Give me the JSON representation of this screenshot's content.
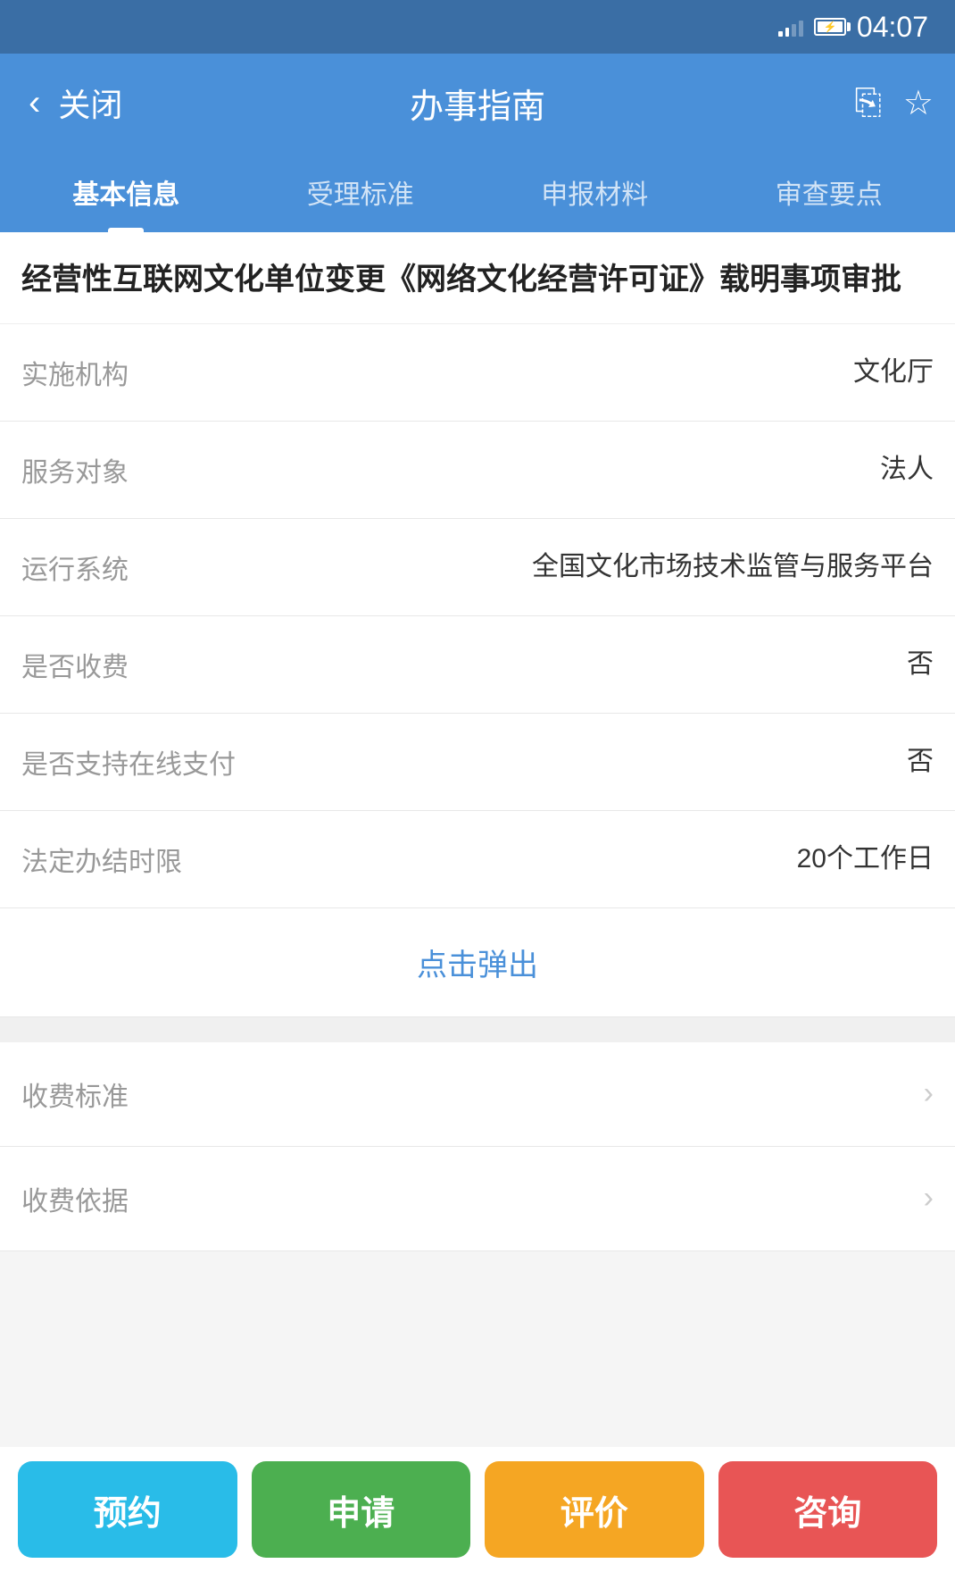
{
  "statusBar": {
    "time": "04:07"
  },
  "navbar": {
    "backLabel": "‹",
    "closeLabel": "关闭",
    "title": "办事指南",
    "shareIcon": "share",
    "starIcon": "star"
  },
  "tabs": [
    {
      "id": "basic",
      "label": "基本信息",
      "active": true
    },
    {
      "id": "standard",
      "label": "受理标准",
      "active": false
    },
    {
      "id": "materials",
      "label": "申报材料",
      "active": false
    },
    {
      "id": "review",
      "label": "审查要点",
      "active": false
    }
  ],
  "pageTitle": "经营性互联网文化单位变更《网络文化经营许可证》载明事项审批",
  "infoRows": [
    {
      "label": "实施机构",
      "value": "文化厅"
    },
    {
      "label": "服务对象",
      "value": "法人"
    },
    {
      "label": "运行系统",
      "value": "全国文化市场技术监管与服务平台"
    },
    {
      "label": "是否收费",
      "value": "否"
    },
    {
      "label": "是否支持在线支付",
      "value": "否"
    },
    {
      "label": "法定办结时限",
      "value": "20个工作日"
    }
  ],
  "popupButton": {
    "label": "点击弹出"
  },
  "listRows": [
    {
      "label": "收费标准"
    },
    {
      "label": "收费依据"
    }
  ],
  "actions": [
    {
      "id": "yuyue",
      "label": "预约",
      "colorClass": "btn-yuyue"
    },
    {
      "id": "shenqing",
      "label": "申请",
      "colorClass": "btn-shenqing"
    },
    {
      "id": "pingjia",
      "label": "评价",
      "colorClass": "btn-pingjia"
    },
    {
      "id": "zixun",
      "label": "咨询",
      "colorClass": "btn-zixun"
    }
  ]
}
